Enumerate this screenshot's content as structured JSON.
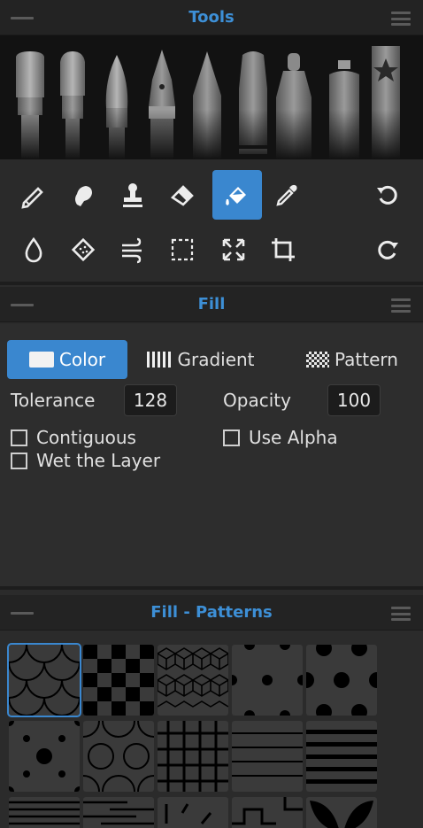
{
  "tools_panel": {
    "title": "Tools",
    "brushes": [
      "flat-brush",
      "round-brush",
      "fine-brush",
      "ink-pen",
      "pencil",
      "marker",
      "felt-tip",
      "spray-can",
      "favorite-brush"
    ]
  },
  "tool_grid": {
    "row1": [
      "pencil-tool-icon",
      "smudge-tool-icon",
      "stamp-tool-icon",
      "eraser-tool-icon",
      "fill-bucket-tool-icon",
      "eyedropper-tool-icon",
      "undo-icon"
    ],
    "row2": [
      "water-drop-tool-icon",
      "texture-tool-icon",
      "blow-tool-icon",
      "selection-tool-icon",
      "transform-tool-icon",
      "crop-tool-icon",
      "redo-icon"
    ],
    "active_tool": "fill-bucket-tool-icon",
    "accent_color": "#3a87cf"
  },
  "fill_panel": {
    "title": "Fill",
    "tabs": [
      {
        "label": "Color",
        "active": true
      },
      {
        "label": "Gradient",
        "active": false
      },
      {
        "label": "Pattern",
        "active": false
      }
    ],
    "tolerance_label": "Tolerance",
    "tolerance_value": "128",
    "opacity_label": "Opacity",
    "opacity_value": "100",
    "contiguous_label": "Contiguous",
    "contiguous_checked": false,
    "use_alpha_label": "Use Alpha",
    "use_alpha_checked": false,
    "wet_layer_label": "Wet the Layer",
    "wet_layer_checked": false
  },
  "patterns_panel": {
    "title": "Fill - Patterns",
    "selected_index": 0,
    "patterns": [
      "scales",
      "checker",
      "cubes",
      "dots-small",
      "dots-large",
      "polka-dots",
      "circles-rings",
      "grid",
      "horizontal-lines",
      "thick-lines",
      "stripes",
      "bricks-lines",
      "dashes",
      "maze",
      "leaves"
    ]
  }
}
